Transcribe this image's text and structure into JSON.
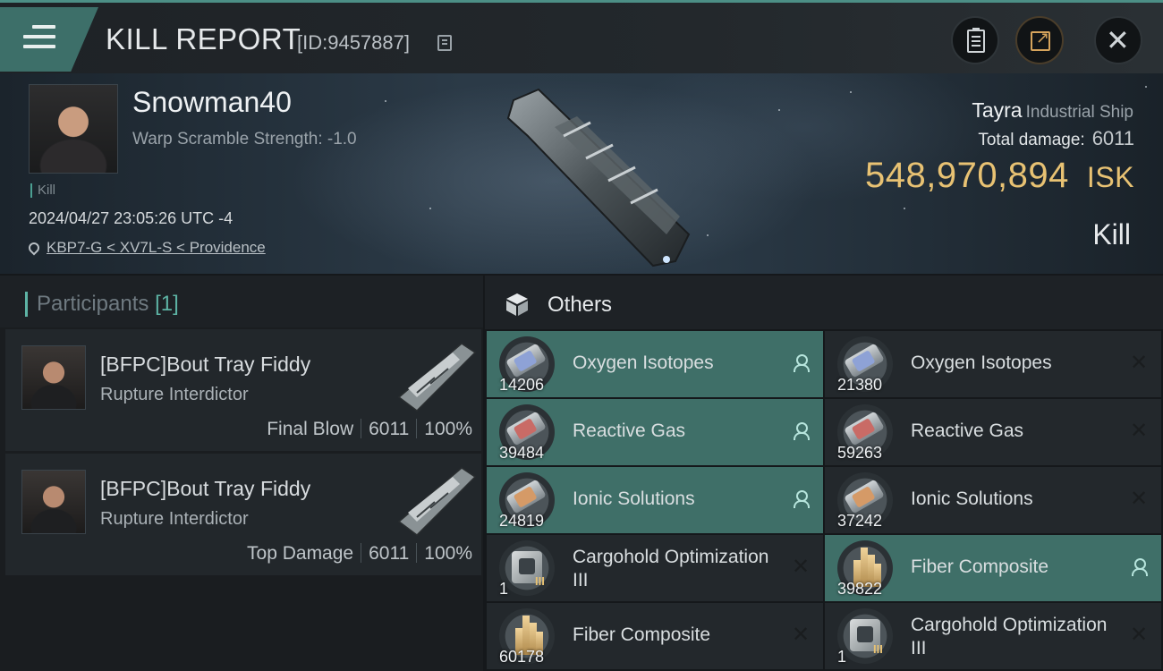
{
  "header": {
    "title": "KILL REPORT",
    "report_id": "[ID:9457887]"
  },
  "victim": {
    "name": "Snowman40",
    "warp_scramble": "Warp Scramble Strength: -1.0",
    "tag": "Kill",
    "time": "2024/04/27 23:05:26 UTC -4",
    "location": "KBP7-G < XV7L-S < Providence",
    "ship": "Tayra",
    "ship_class": "Industrial Ship",
    "total_damage_label": "Total damage:",
    "total_damage": "6011",
    "isk_value": "548,970,894",
    "isk_unit": "ISK",
    "result": "Kill"
  },
  "participants": {
    "title": "Participants",
    "count": "[1]",
    "items": [
      {
        "name": "[BFPC]Bout Tray Fiddy",
        "ship": "Rupture Interdictor",
        "role": "Final Blow",
        "damage": "6011",
        "percent": "100%"
      },
      {
        "name": "[BFPC]Bout Tray Fiddy",
        "ship": "Rupture Interdictor",
        "role": "Top Damage",
        "damage": "6011",
        "percent": "100%"
      }
    ]
  },
  "others": {
    "title": "Others",
    "items": [
      {
        "name": "Oxygen Isotopes",
        "qty": "14206",
        "state": "dropped",
        "icon": "oxygen-canister"
      },
      {
        "name": "Oxygen Isotopes",
        "qty": "21380",
        "state": "destroyed",
        "icon": "oxygen-canister"
      },
      {
        "name": "Reactive Gas",
        "qty": "39484",
        "state": "dropped",
        "icon": "gas-canister"
      },
      {
        "name": "Reactive Gas",
        "qty": "59263",
        "state": "destroyed",
        "icon": "gas-canister"
      },
      {
        "name": "Ionic Solutions",
        "qty": "24819",
        "state": "dropped",
        "icon": "ionic-canister"
      },
      {
        "name": "Ionic Solutions",
        "qty": "37242",
        "state": "destroyed",
        "icon": "ionic-canister"
      },
      {
        "name": "Cargohold Optimization III",
        "qty": "1",
        "state": "destroyed",
        "icon": "cargohold-module",
        "tier": "III"
      },
      {
        "name": "Fiber Composite",
        "qty": "39822",
        "state": "dropped",
        "icon": "fiber-composite"
      },
      {
        "name": "Fiber Composite",
        "qty": "60178",
        "state": "destroyed",
        "icon": "fiber-composite"
      },
      {
        "name": "Cargohold Optimization III",
        "qty": "1",
        "state": "destroyed",
        "icon": "cargohold-module",
        "tier": "III"
      }
    ]
  },
  "colors": {
    "accent": "#4b9f92",
    "isk": "#e8c273",
    "dropped_row": "#3f6f68"
  }
}
